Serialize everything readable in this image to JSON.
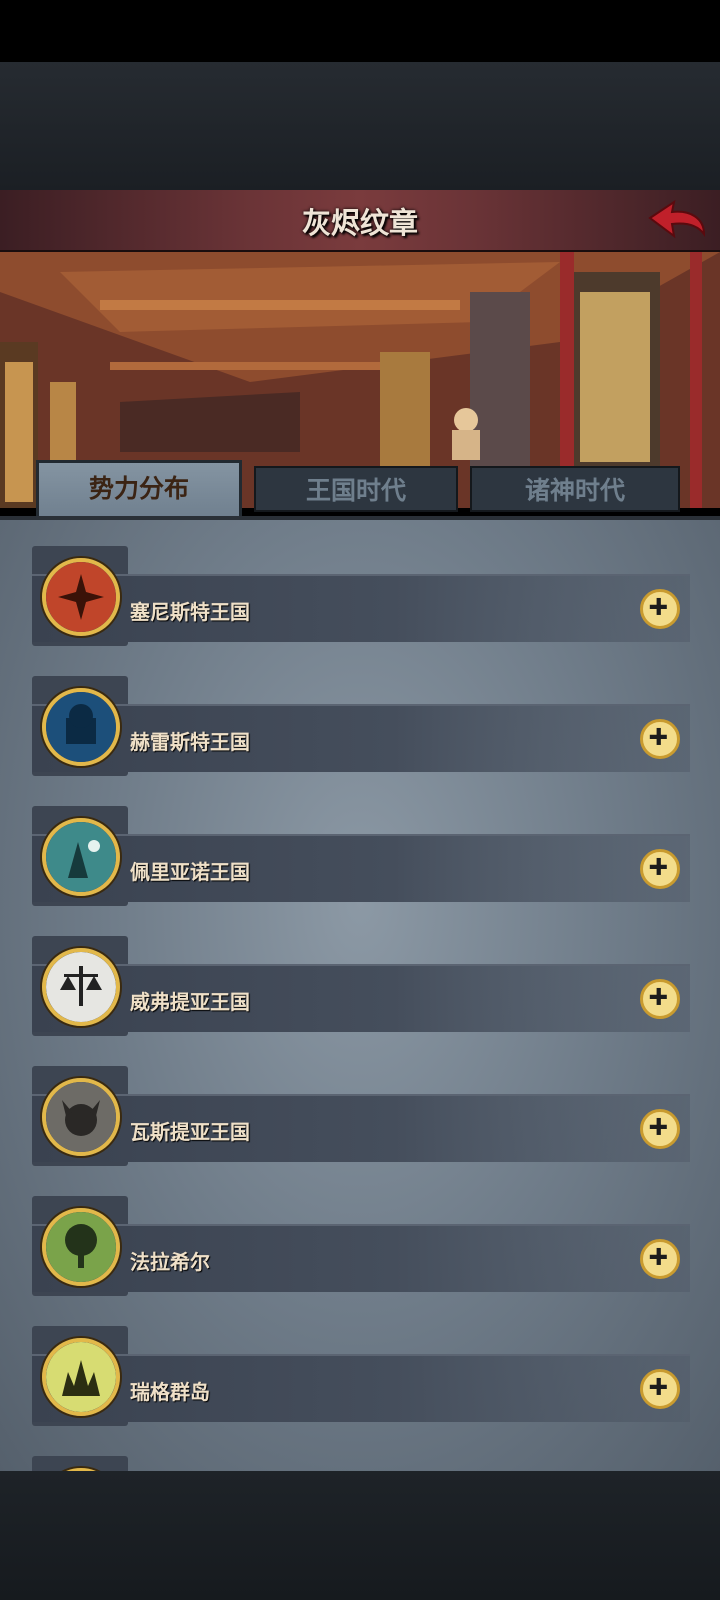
{
  "header": {
    "title": "灰烬纹章"
  },
  "tabs": [
    {
      "label": "势力分布",
      "active": true
    },
    {
      "label": "王国时代",
      "active": false
    },
    {
      "label": "诸神时代",
      "active": false
    }
  ],
  "factions": [
    {
      "name": "塞尼斯特王国",
      "emblem_color": "#c0452a"
    },
    {
      "name": "赫雷斯特王国",
      "emblem_color": "#1c4f7a"
    },
    {
      "name": "佩里亚诺王国",
      "emblem_color": "#3e8a8a"
    },
    {
      "name": "威弗提亚王国",
      "emblem_color": "#e6e6e2"
    },
    {
      "name": "瓦斯提亚王国",
      "emblem_color": "#6d6b66"
    },
    {
      "name": "法拉希尔",
      "emblem_color": "#7aa34a"
    },
    {
      "name": "瑞格群岛",
      "emblem_color": "#d7dc72"
    }
  ],
  "colors": {
    "accent_gold": "#e2b84a",
    "back_arrow": "#c0202a"
  }
}
